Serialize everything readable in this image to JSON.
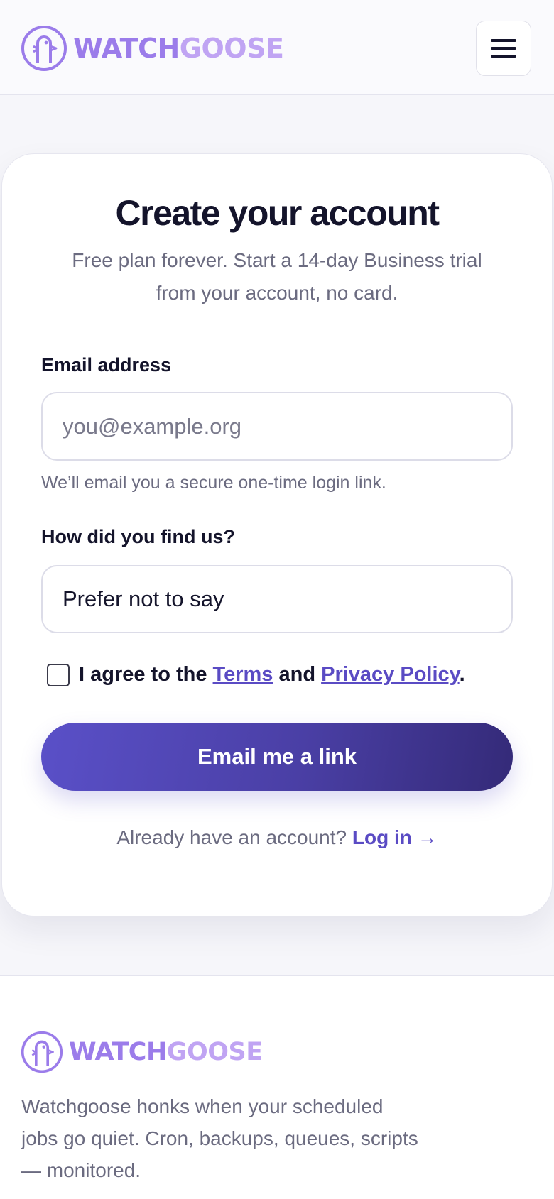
{
  "brand": {
    "name_part1": "WATCH",
    "name_part2": "GOOSE",
    "color_primary": "#9b7cea",
    "color_secondary": "#c0a4f3"
  },
  "header": {
    "menu_icon": "hamburger-menu-icon"
  },
  "signup": {
    "title": "Create your account",
    "subtitle": "Free plan forever. Start a 14-day Business trial from your account, no card.",
    "email_label": "Email address",
    "email_placeholder": "you@example.org",
    "email_value": "",
    "email_hint": "We’ll email you a secure one-time login link.",
    "source_label": "How did you find us?",
    "source_value": "Prefer not to say",
    "agree_prefix": "I agree to the ",
    "terms_link": "Terms",
    "agree_and": " and ",
    "privacy_link": "Privacy Policy",
    "agree_suffix": ".",
    "agree_checked": false,
    "submit_label": "Email me a link",
    "login_prompt": "Already have an account? ",
    "login_link": "Log in →",
    "accent_color": "#5a4bc4"
  },
  "footer": {
    "description": "Watchgoose honks when your scheduled jobs go quiet. Cron, backups, queues, scripts — monitored."
  }
}
